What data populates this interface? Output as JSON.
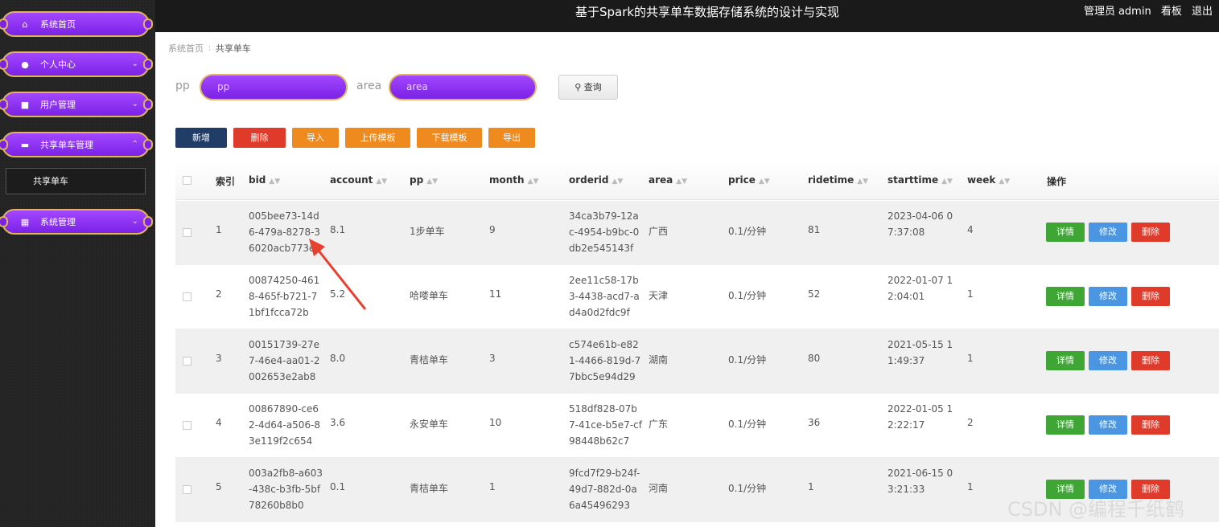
{
  "header": {
    "title": "基于Spark的共享单车数据存储系统的设计与实现",
    "user_role": "管理员",
    "username": "admin",
    "dashboard_link": "看板",
    "logout_link": "退出"
  },
  "sidebar": {
    "items": [
      {
        "label": "系统首页",
        "icon": "home-icon"
      },
      {
        "label": "个人中心",
        "icon": "user-icon"
      },
      {
        "label": "用户管理",
        "icon": "users-icon"
      },
      {
        "label": "共享单车管理",
        "icon": "bike-icon"
      },
      {
        "label": "系统管理",
        "icon": "grid-icon"
      }
    ],
    "submenu_item": "共享单车"
  },
  "breadcrumb": {
    "home": "系统首页",
    "current": "共享单车"
  },
  "search": {
    "pp_label": "pp",
    "pp_placeholder": "pp",
    "area_label": "area",
    "area_placeholder": "area",
    "query_button": "查询"
  },
  "toolbar": {
    "add": "新增",
    "delete": "删除",
    "import": "导入",
    "upload_template": "上传模板",
    "download_template": "下载模板",
    "export": "导出"
  },
  "colors": {
    "add": "#1f3d66",
    "delete": "#e03a2b",
    "orange": "#ee8a1e",
    "detail": "#3fa535",
    "edit": "#4a96e3",
    "row_delete": "#e03a2b",
    "pill_purple": "#8b2cf0",
    "pill_border": "#e0b45a"
  },
  "table": {
    "columns": [
      "索引",
      "bid",
      "account",
      "pp",
      "month",
      "orderid",
      "area",
      "price",
      "ridetime",
      "starttime",
      "week",
      "操作"
    ],
    "actions": {
      "detail": "详情",
      "edit": "修改",
      "delete": "删除"
    },
    "rows": [
      {
        "index": "1",
        "bid": "005bee73-14d6-479a-8278-36020acb773e",
        "account": "8.1",
        "pp": "1步单车",
        "month": "9",
        "orderid": "34ca3b79-12ac-4954-b9bc-0db2e545143f",
        "area": "广西",
        "price": "0.1/分钟",
        "ridetime": "81",
        "starttime": "2023-04-06 07:37:08",
        "week": "4"
      },
      {
        "index": "2",
        "bid": "00874250-4618-465f-b721-71bf1fcca72b",
        "account": "5.2",
        "pp": "哈喽单车",
        "month": "11",
        "orderid": "2ee11c58-17b3-4438-acd7-ad4a0d2fdc9f",
        "area": "天津",
        "price": "0.1/分钟",
        "ridetime": "52",
        "starttime": "2022-01-07 12:04:01",
        "week": "1"
      },
      {
        "index": "3",
        "bid": "00151739-27e7-46e4-aa01-2002653e2ab8",
        "account": "8.0",
        "pp": "青桔单车",
        "month": "3",
        "orderid": "c574e61b-e821-4466-819d-77bbc5e94d29",
        "area": "湖南",
        "price": "0.1/分钟",
        "ridetime": "80",
        "starttime": "2021-05-15 11:49:37",
        "week": "1"
      },
      {
        "index": "4",
        "bid": "00867890-ce62-4d64-a506-83e119f2c654",
        "account": "3.6",
        "pp": "永安单车",
        "month": "10",
        "orderid": "518df828-07b7-41ce-b5e7-cf98448b62c7",
        "area": "广东",
        "price": "0.1/分钟",
        "ridetime": "36",
        "starttime": "2022-01-05 12:22:17",
        "week": "2"
      },
      {
        "index": "5",
        "bid": "003a2fb8-a603-438c-b3fb-5bf78260b8b0",
        "account": "0.1",
        "pp": "青桔单车",
        "month": "1",
        "orderid": "9fcd7f29-b24f-49d7-882d-0a6a45496293",
        "area": "河南",
        "price": "0.1/分钟",
        "ridetime": "1",
        "starttime": "2021-06-15 03:21:33",
        "week": "1"
      }
    ]
  },
  "watermark": "CSDN @编程千纸鹤"
}
